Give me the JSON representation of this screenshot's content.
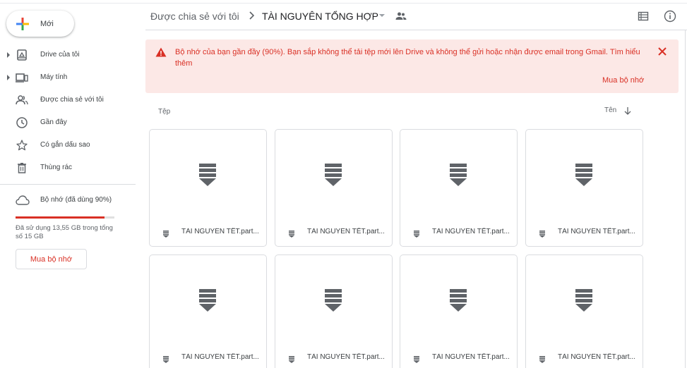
{
  "sidebar": {
    "new_label": "Mới",
    "items": [
      {
        "label": "Drive của tôi",
        "icon": "drive-icon",
        "expandable": true
      },
      {
        "label": "Máy tính",
        "icon": "computer-icon",
        "expandable": true
      },
      {
        "label": "Được chia sẻ với tôi",
        "icon": "shared-icon",
        "expandable": false
      },
      {
        "label": "Gần đây",
        "icon": "clock-icon",
        "expandable": false
      },
      {
        "label": "Có gắn dấu sao",
        "icon": "star-icon",
        "expandable": false
      },
      {
        "label": "Thùng rác",
        "icon": "trash-icon",
        "expandable": false
      }
    ],
    "storage": {
      "label": "Bộ nhớ (đã dùng 90%)",
      "used_fraction": 0.9,
      "used_text": "Đã sử dụng 13,55 GB trong tổng số 15 GB",
      "buy_label": "Mua bộ nhớ"
    }
  },
  "header": {
    "breadcrumb_parent": "Được chia sẻ với tôi",
    "breadcrumb_current": "TÀI NGUYÊN TỔNG HỢP"
  },
  "alert": {
    "message": "Bộ nhớ của bạn gần đầy (90%). Bạn sắp không thể tải tệp mới lên Drive và không thể gửi hoặc nhận được email trong Gmail.",
    "link": "Tìm hiểu thêm",
    "buy_label": "Mua bộ nhớ"
  },
  "content": {
    "section_label": "Tệp",
    "sort_label": "Tên",
    "files": [
      {
        "name": "TÀI NGUYÊN TẾT.part..."
      },
      {
        "name": "TÀI NGUYÊN TẾT.part..."
      },
      {
        "name": "TÀI NGUYÊN TẾT.part..."
      },
      {
        "name": "TÀI NGUYÊN TẾT.part..."
      },
      {
        "name": "TÀI NGUYÊN TẾT.part..."
      },
      {
        "name": "TÀI NGUYÊN TẾT.part..."
      },
      {
        "name": "TÀI NGUYÊN TẾT.part..."
      },
      {
        "name": "TÀI NGUYÊN TẾT.part..."
      }
    ]
  },
  "colors": {
    "danger": "#d93025",
    "alert_bg": "#fce8e6",
    "icon_gray": "#5f6368",
    "border": "#dadce0"
  }
}
